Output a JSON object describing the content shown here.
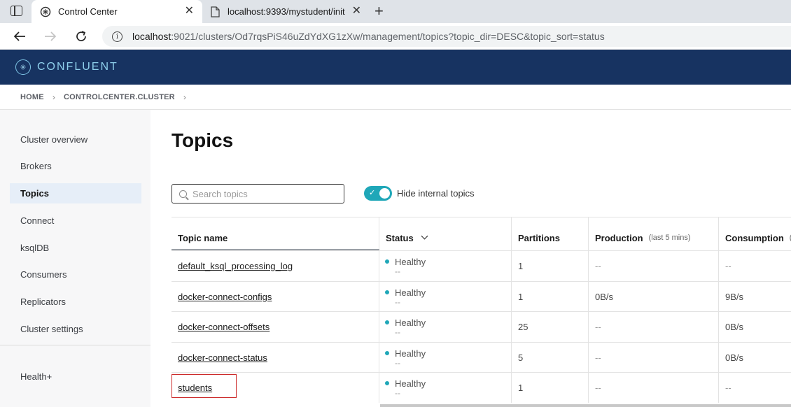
{
  "browser": {
    "tabs": [
      {
        "title": "Control Center",
        "active": true,
        "icon": "confluent-favicon-icon"
      },
      {
        "title": "localhost:9393/mystudent/init",
        "active": false,
        "icon": "page-icon"
      }
    ],
    "url_host": "localhost",
    "url_rest": ":9021/clusters/Od7rqsPiS46uZdYdXG1zXw/management/topics?topic_dir=DESC&topic_sort=status"
  },
  "app": {
    "brand": "CONFLUENT",
    "brand_color": "#173361"
  },
  "breadcrumb": [
    "HOME",
    "CONTROLCENTER.CLUSTER"
  ],
  "sidebar": {
    "items": [
      {
        "label": "Cluster overview",
        "active": false
      },
      {
        "label": "Brokers",
        "active": false
      },
      {
        "label": "Topics",
        "active": true
      },
      {
        "label": "Connect",
        "active": false
      },
      {
        "label": "ksqlDB",
        "active": false
      },
      {
        "label": "Consumers",
        "active": false
      },
      {
        "label": "Replicators",
        "active": false
      },
      {
        "label": "Cluster settings",
        "active": false
      }
    ],
    "footer_item": "Health+"
  },
  "main": {
    "title": "Topics",
    "search_placeholder": "Search topics",
    "toggle_label": "Hide internal topics",
    "toggle_on": true,
    "columns": {
      "topic": "Topic name",
      "status": "Status",
      "partitions": "Partitions",
      "production": "Production",
      "production_sub": "(last 5 mins)",
      "consumption": "Consumption",
      "consumption_sub": "("
    },
    "rows": [
      {
        "name": "default_ksql_processing_log",
        "status": "Healthy",
        "status_sub": "--",
        "partitions": "1",
        "production": "--",
        "consumption": "--"
      },
      {
        "name": "docker-connect-configs",
        "status": "Healthy",
        "status_sub": "--",
        "partitions": "1",
        "production": "0B/s",
        "consumption": "9B/s"
      },
      {
        "name": "docker-connect-offsets",
        "status": "Healthy",
        "status_sub": "--",
        "partitions": "25",
        "production": "--",
        "consumption": "0B/s"
      },
      {
        "name": "docker-connect-status",
        "status": "Healthy",
        "status_sub": "--",
        "partitions": "5",
        "production": "--",
        "consumption": "0B/s"
      },
      {
        "name": "students",
        "status": "Healthy",
        "status_sub": "--",
        "partitions": "1",
        "production": "--",
        "consumption": "--"
      }
    ]
  }
}
